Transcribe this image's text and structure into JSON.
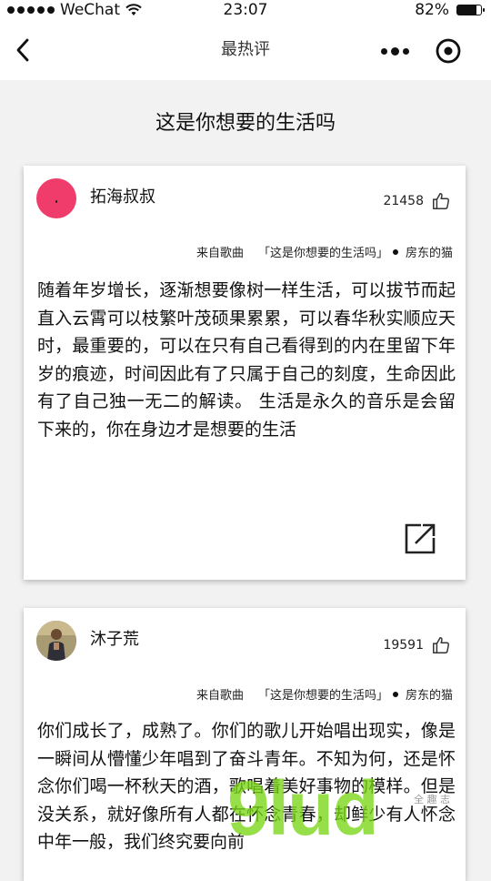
{
  "status_bar": {
    "carrier": "WeChat",
    "time": "23:07",
    "battery": "82%",
    "battery_level": 0.82
  },
  "nav": {
    "title": "最热评"
  },
  "page": {
    "heading": "这是你想要的生活吗"
  },
  "comments": [
    {
      "user": "拓海叔叔",
      "likes": "21458",
      "source_prefix": "来自歌曲",
      "song": "「这是你想要的生活吗」",
      "artist": "房东的猫",
      "text": "随着年岁增长，逐渐想要像树一样生活，可以拔节而起直入云霄可以枝繁叶茂硕果累累，可以春华秋实顺应天时，最重要的，可以在只有自己看得到的内在里留下年岁的痕迹，时间因此有了只属于自己的刻度，生命因此有了自己独一无二的解读。 生活是永久的音乐是会留下来的，你在身边才是想要的生活"
    },
    {
      "user": "沐子荒",
      "likes": "19591",
      "source_prefix": "来自歌曲",
      "song": "「这是你想要的生活吗」",
      "artist": "房东的猫",
      "text": "你们成长了，成熟了。你们的歌儿开始唱出现实，像是一瞬间从懵懂少年唱到了奋斗青年。不知为何，还是怀念你们喝一杯秋天的酒，歌唱着美好事物的模样。但是没关系，就好像所有人都在怀念青春，却鲜少有人怀念中年一般，我们终究要向前"
    }
  ],
  "watermark": {
    "text": "9lud",
    "small": "全 趣 志"
  },
  "colors": {
    "accent_pink": "#ef3c6a",
    "watermark_green": "#78d614"
  }
}
